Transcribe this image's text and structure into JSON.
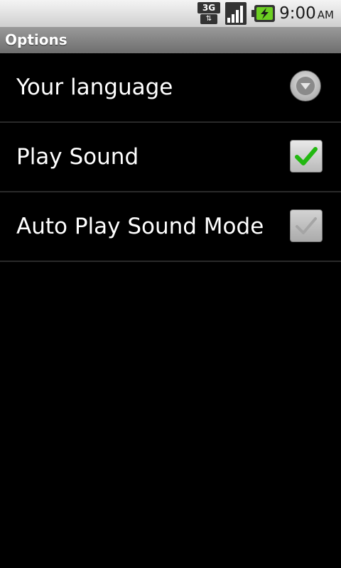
{
  "status_bar": {
    "network_type": "3G",
    "time": "9:00",
    "ampm": "AM",
    "icons": [
      "network-3g-icon",
      "signal-strength-icon",
      "battery-charging-icon"
    ]
  },
  "title_bar": {
    "title": "Options"
  },
  "options": [
    {
      "label": "Your language",
      "widget": "dropdown",
      "state": "collapsed"
    },
    {
      "label": "Play Sound",
      "widget": "checkbox",
      "checked": true,
      "enabled": true
    },
    {
      "label": "Auto Play Sound Mode",
      "widget": "checkbox",
      "checked": true,
      "enabled": false
    }
  ],
  "colors": {
    "background": "#000000",
    "title_bar": "#8a8a8a",
    "check_green": "#22b811",
    "check_disabled": "#9c9c9c",
    "divider": "#2a2a2a"
  }
}
